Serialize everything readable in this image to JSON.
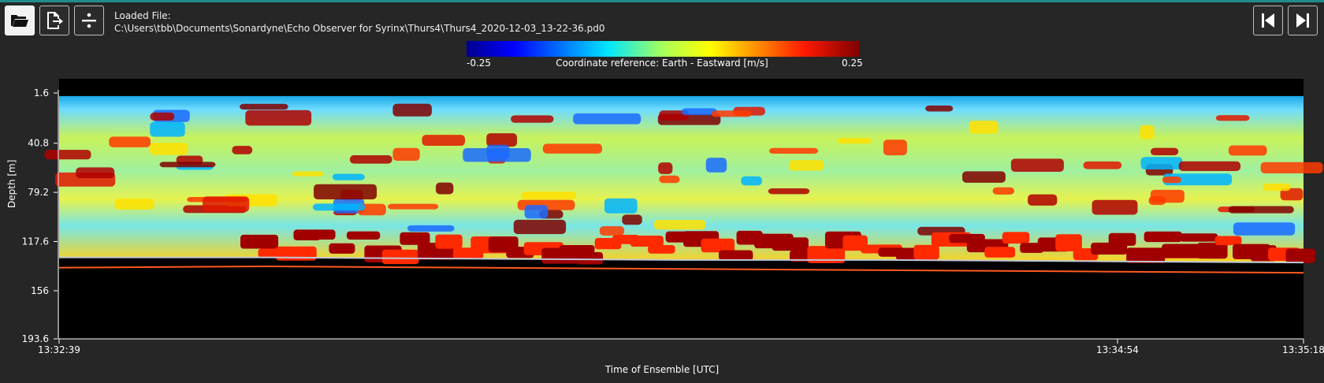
{
  "toolbar": {
    "open_icon": "folder-open-icon",
    "export_icon": "export-file-icon",
    "divide_icon": "divide-icon",
    "prev_icon": "skip-previous-icon",
    "next_icon": "skip-next-icon"
  },
  "file": {
    "label": "Loaded File:",
    "path": "C:\\Users\\tbb\\Documents\\Sonardyne\\Echo Observer for Syrinx\\Thurs4\\Thurs4_2020-12-03_13-22-36.pd0"
  },
  "colorbar": {
    "min": "-0.25",
    "max": "0.25",
    "title": "Coordinate reference: Earth - Eastward [m/s]"
  },
  "colors": {
    "accent": "#1f8c8c",
    "background": "#262626",
    "plot_bg": "#000000",
    "bottom_line": "#ff5a1f"
  },
  "chart_data": {
    "type": "heatmap",
    "title": "",
    "xlabel": "Time of Ensemble [UTC]",
    "ylabel": "Depth [m]",
    "ylim": [
      1.6,
      193.6
    ],
    "y_ticks": [
      "1.6",
      "40.8",
      "79.2",
      "117.6",
      "156",
      "193.6"
    ],
    "x_ticks": [
      "13:32:39",
      "13:34:54",
      "13:35:18"
    ],
    "color_scale": {
      "min": -0.25,
      "max": 0.25,
      "map": "jet"
    },
    "seabed_depth_m": [
      138,
      137,
      138,
      139,
      140,
      141,
      142
    ],
    "bottom_track_depth_m": [
      130,
      130,
      131,
      132,
      132,
      133,
      134
    ]
  }
}
